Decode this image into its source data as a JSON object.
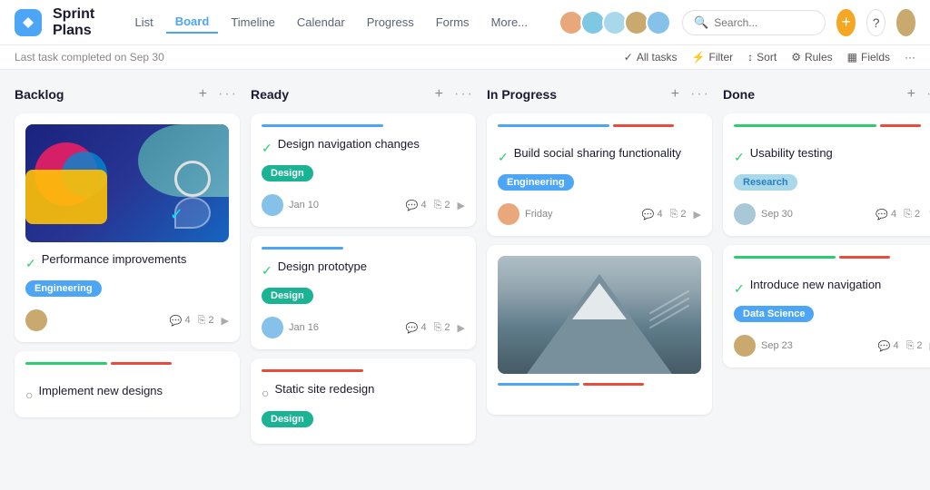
{
  "app": {
    "icon_label": "T",
    "title": "Sprint Plans"
  },
  "nav": {
    "links": [
      "List",
      "Board",
      "Timeline",
      "Calendar",
      "Progress",
      "Forms",
      "More..."
    ],
    "active": "Board"
  },
  "subtitle": {
    "last_task": "Last task completed on Sep 30"
  },
  "filters": {
    "all_tasks": "All tasks",
    "filter": "Filter",
    "sort": "Sort",
    "rules": "Rules",
    "fields": "Fields"
  },
  "columns": [
    {
      "id": "backlog",
      "title": "Backlog",
      "cards": [
        {
          "id": "card-backlog-1",
          "has_image": true,
          "image_type": "colorful",
          "title": "Performance improvements",
          "check_state": "done",
          "tag": "Engineering",
          "tag_class": "tag-engineering",
          "avatar_color": "#c9a96e",
          "meta_likes": "4",
          "meta_comments": "2",
          "has_arrow": true
        },
        {
          "id": "card-backlog-2",
          "title": "Implement new designs",
          "check_state": "pending",
          "bars": [
            {
              "color": "#2ecc71",
              "width": "40%"
            },
            {
              "color": "#e74c3c",
              "width": "30%"
            }
          ]
        }
      ]
    },
    {
      "id": "ready",
      "title": "Ready",
      "cards": [
        {
          "id": "card-ready-1",
          "title": "Design navigation changes",
          "check_state": "done",
          "tag": "Design",
          "tag_class": "tag-design",
          "date": "Jan 10",
          "avatar_color": "#85c1e9",
          "meta_likes": "4",
          "meta_comments": "2",
          "has_arrow": true,
          "bar_color": "#4da6f5",
          "bar_width": "60%"
        },
        {
          "id": "card-ready-2",
          "title": "Design prototype",
          "check_state": "done",
          "tag": "Design",
          "tag_class": "tag-design",
          "date": "Jan 16",
          "avatar_color": "#85c1e9",
          "meta_likes": "4",
          "meta_comments": "2",
          "has_arrow": true,
          "bar_color": "#4da6f5",
          "bar_width": "40%"
        },
        {
          "id": "card-ready-3",
          "title": "Static site redesign",
          "check_state": "pending",
          "tag": "Design",
          "tag_class": "tag-design",
          "bar_color": "#e74c3c",
          "bar_width": "50%"
        }
      ]
    },
    {
      "id": "inprogress",
      "title": "In Progress",
      "cards": [
        {
          "id": "card-ip-1",
          "title": "Build social sharing functionality",
          "check_state": "done",
          "tag": "Engineering",
          "tag_class": "tag-engineering",
          "date": "Friday",
          "avatar_color": "#e8a87c",
          "meta_likes": "4",
          "meta_comments": "2",
          "has_arrow": true,
          "bar_color": "#4da6f5",
          "bar_width": "55%"
        },
        {
          "id": "card-ip-2",
          "has_image": true,
          "image_type": "mountain",
          "bars": [
            {
              "color": "#4da6f5",
              "width": "40%"
            },
            {
              "color": "#e74c3c",
              "width": "30%"
            }
          ]
        }
      ]
    },
    {
      "id": "done",
      "title": "Done",
      "cards": [
        {
          "id": "card-done-1",
          "title": "Usability testing",
          "check_state": "done",
          "tag": "Research",
          "tag_class": "tag-research",
          "date": "Sep 30",
          "avatar_color": "#a8c8d8",
          "meta_likes": "4",
          "meta_comments": "2",
          "has_arrow": true,
          "bar_color": "#2ecc71",
          "bar_width": "70%",
          "second_bar_color": "#e74c3c",
          "second_bar_width": "20%"
        },
        {
          "id": "card-done-2",
          "title": "Introduce new navigation",
          "check_state": "done",
          "tag": "Data Science",
          "tag_class": "tag-datascience",
          "date": "Sep 23",
          "avatar_color": "#c9a96e",
          "meta_likes": "4",
          "meta_comments": "2",
          "has_arrow": true,
          "bar_color": "#2ecc71",
          "bar_width": "50%",
          "second_bar_color": "#e74c3c",
          "second_bar_width": "25%"
        }
      ]
    }
  ]
}
